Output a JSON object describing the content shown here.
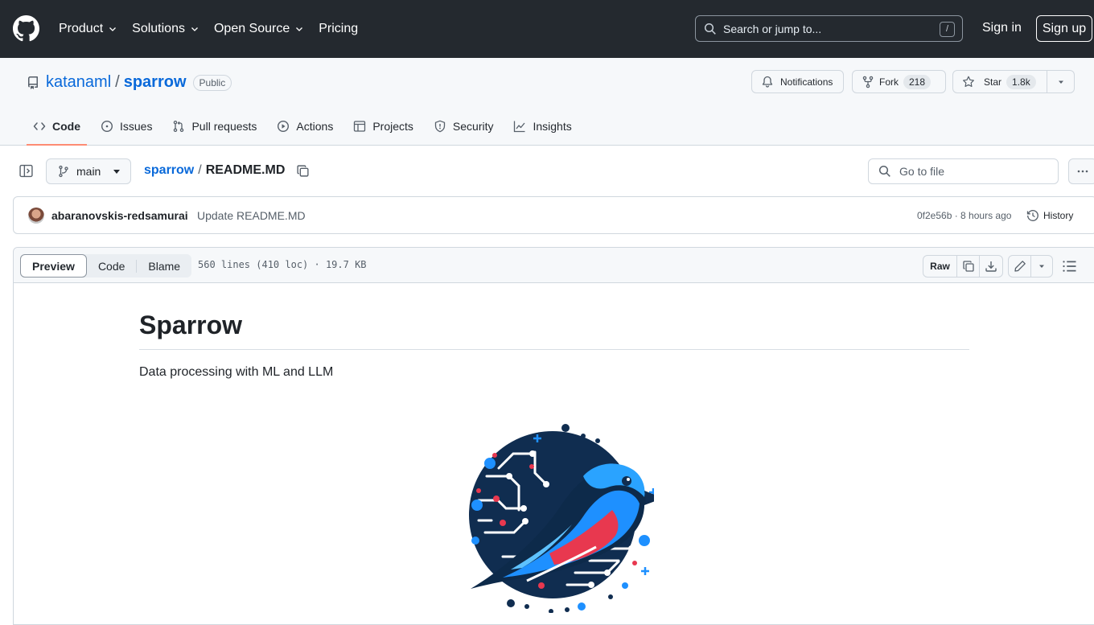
{
  "header": {
    "nav": [
      "Product",
      "Solutions",
      "Open Source",
      "Pricing"
    ],
    "nav_has_dropdown": [
      true,
      true,
      true,
      false
    ],
    "search_placeholder": "Search or jump to...",
    "search_shortcut": "/",
    "sign_in": "Sign in",
    "sign_up": "Sign up",
    "bg_color": "#24292f"
  },
  "repo": {
    "owner": "katanaml",
    "separator": "/",
    "name": "sparrow",
    "visibility": "Public",
    "notifications_label": "Notifications",
    "fork_label": "Fork",
    "fork_count": "218",
    "star_label": "Star",
    "star_count": "1.8k"
  },
  "tabs": [
    {
      "label": "Code",
      "icon": "code-icon",
      "active": true
    },
    {
      "label": "Issues",
      "icon": "issue-opened-icon"
    },
    {
      "label": "Pull requests",
      "icon": "git-pull-request-icon"
    },
    {
      "label": "Actions",
      "icon": "play-icon"
    },
    {
      "label": "Projects",
      "icon": "table-icon"
    },
    {
      "label": "Security",
      "icon": "shield-icon"
    },
    {
      "label": "Insights",
      "icon": "graph-icon"
    }
  ],
  "filebar": {
    "branch": "main",
    "crumb_repo": "sparrow",
    "crumb_sep": "/",
    "crumb_file": "README.MD",
    "goto_placeholder": "Go to file"
  },
  "commit": {
    "author": "abaranovskis-redsamurai",
    "message": "Update README.MD",
    "meta": "0f2e56b · 8 hours ago",
    "history_label": "History"
  },
  "viewer": {
    "modes": [
      "Preview",
      "Code",
      "Blame"
    ],
    "active_mode": "Preview",
    "stats": "560 lines (410 loc) · 19.7 KB",
    "raw_label": "Raw"
  },
  "readme": {
    "title": "Sparrow",
    "description": "Data processing with ML and LLM"
  },
  "colors": {
    "link": "#0969da",
    "active_tab_underline": "#fd8c73",
    "logo_blue": "#1e90ff",
    "logo_navy": "#0d2a4a",
    "logo_red": "#e8384f"
  }
}
